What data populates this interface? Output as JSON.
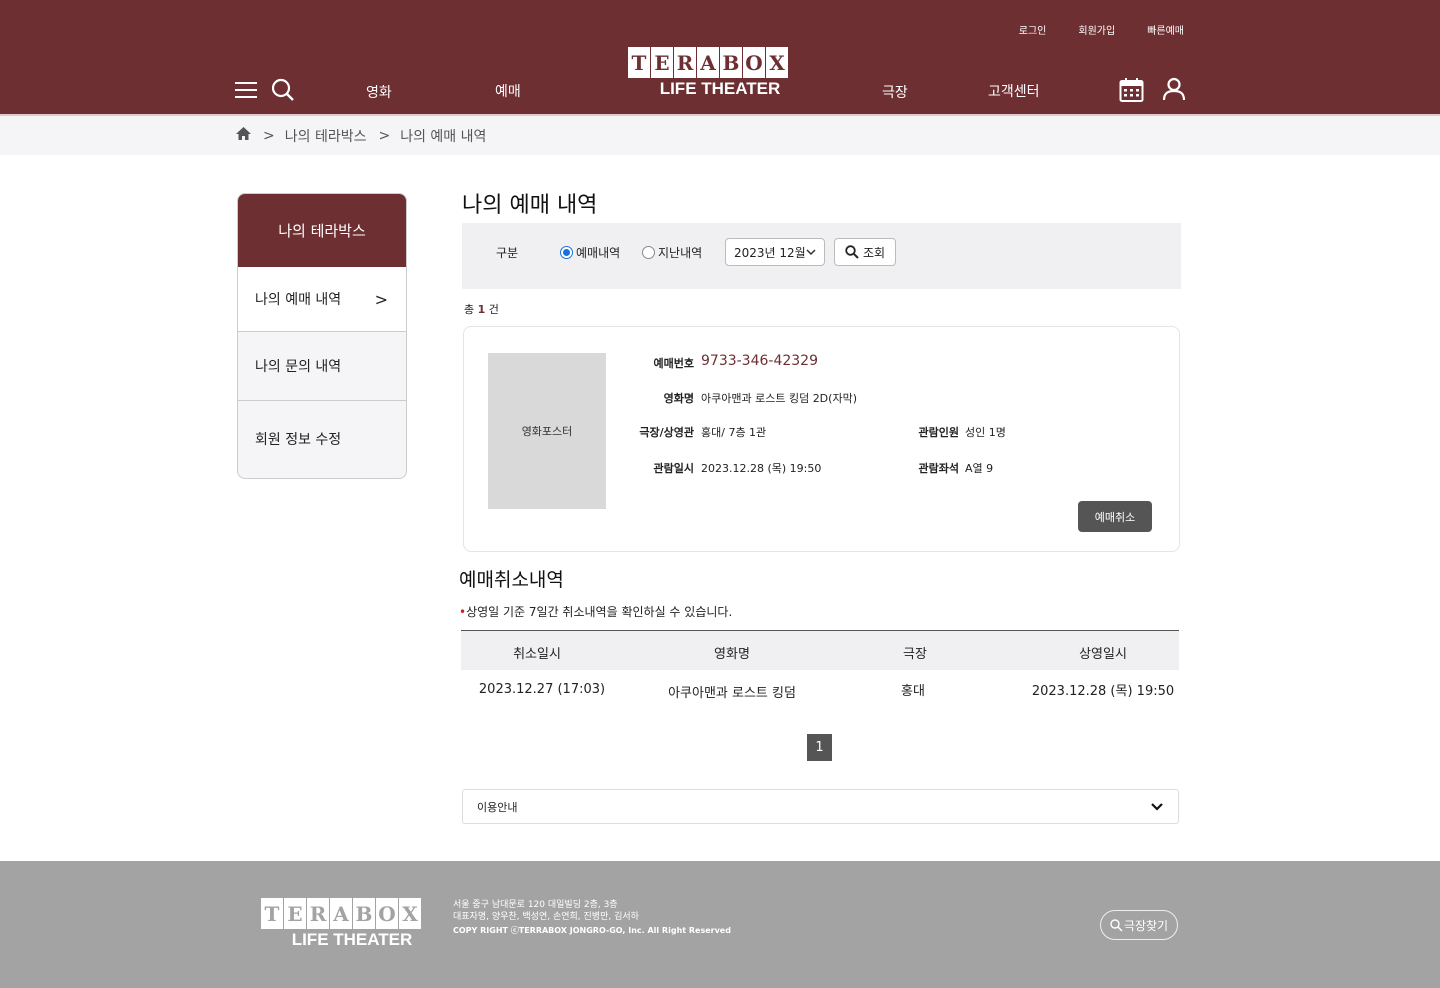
{
  "header": {
    "top_links": [
      "로그인",
      "회원가입",
      "빠른예매"
    ],
    "nav": {
      "movie": "영화",
      "reserve": "예매",
      "theater": "극장",
      "support": "고객센터"
    },
    "logo": {
      "letters": [
        "T",
        "E",
        "R",
        "A",
        "B",
        "O",
        "X"
      ],
      "subtitle": "LIFE THEATER"
    },
    "brand_color": "#6d2f32"
  },
  "breadcrumb": {
    "level1": "나의 테라박스",
    "level2": "나의 예매 내역",
    "separator": ">"
  },
  "sidebar": {
    "title": "나의 테라박스",
    "items": [
      {
        "label": "나의 예매 내역",
        "arrow": ">"
      },
      {
        "label": "나의 문의 내역"
      },
      {
        "label": "회원 정보 수정"
      }
    ]
  },
  "main": {
    "title": "나의 예매 내역",
    "filter": {
      "label": "구분",
      "radio_current": "예매내역",
      "radio_past": "지난내역",
      "month": "2023년 12월",
      "search_label": "조회"
    },
    "total": {
      "prefix": "총",
      "count": "1",
      "suffix": "건"
    },
    "ticket": {
      "poster_placeholder": "영화포스터",
      "labels": {
        "resno": "예매번호",
        "movie": "영화명",
        "theater": "극장/상영관",
        "people": "관람인원",
        "datetime": "관람일시",
        "seat": "관람좌석"
      },
      "resno": "9733-346-42329",
      "movie": "아쿠아맨과 로스트 킹덤 2D(자막)",
      "theater": "홍대/ 7층 1관",
      "people": "성인 1명",
      "datetime": "2023.12.28 (목) 19:50",
      "seat": "A열 9",
      "cancel_button": "예매취소"
    },
    "cancel_history": {
      "title": "예매취소내역",
      "bullet": "•",
      "note": "상영일 기준 7일간 취소내역을 확인하실 수 있습니다.",
      "columns": [
        "취소일시",
        "영화명",
        "극장",
        "상영일시"
      ],
      "rows": [
        [
          "2023.12.27 (17:03)",
          "아쿠아맨과 로스트 킹덤",
          "홍대",
          "2023.12.28 (목) 19:50"
        ]
      ]
    },
    "pagination": {
      "current": "1"
    },
    "guide_label": "이용안내"
  },
  "footer": {
    "logo_letters": [
      "T",
      "E",
      "R",
      "A",
      "B",
      "O",
      "X"
    ],
    "logo_subtitle": "LIFE THEATER",
    "address": "서울 중구 남대문로 120 대일빌딩 2층, 3층",
    "ceo": "대표자명, 양우찬, 백성연, 손연희, 진병만, 김서하",
    "copyright": "COPY RIGHT ⓒTERRABOX JONGRO-GO, Inc. All Right Reserved",
    "find_theater": "극장찾기"
  }
}
